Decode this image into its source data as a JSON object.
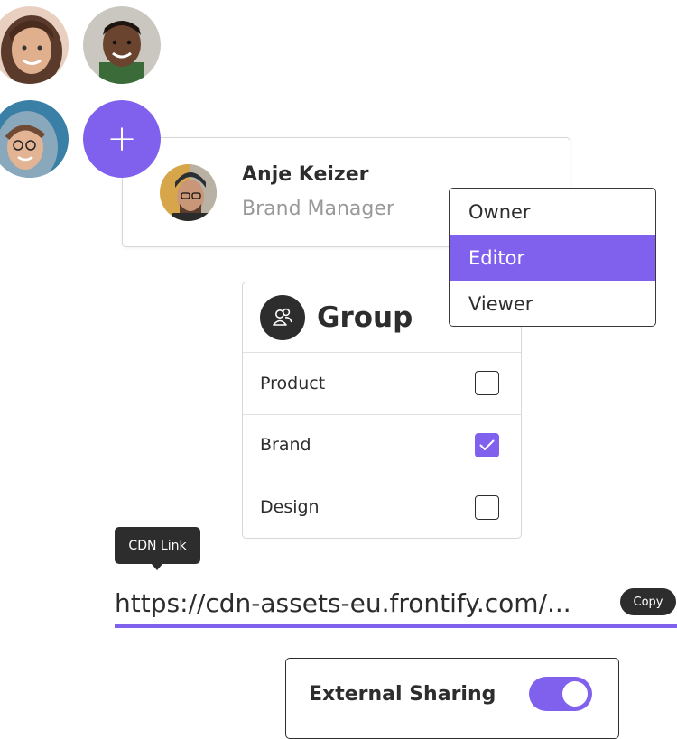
{
  "colors": {
    "accent": "#8061ee",
    "dark": "#2d2d2d"
  },
  "avatars": [
    {
      "name": "avatar-woman-smiling"
    },
    {
      "name": "avatar-man-smiling"
    },
    {
      "name": "avatar-woman-hoodie"
    }
  ],
  "add_button": {
    "label": "+",
    "icon": "plus-icon"
  },
  "user_card": {
    "name": "Anje Keizer",
    "role": "Brand Manager"
  },
  "role_menu": {
    "options": [
      "Owner",
      "Editor",
      "Viewer"
    ],
    "selected": "Editor"
  },
  "group": {
    "title": "Group",
    "icon": "group-icon",
    "items": [
      {
        "label": "Product",
        "checked": false
      },
      {
        "label": "Brand",
        "checked": true
      },
      {
        "label": "Design",
        "checked": false
      }
    ]
  },
  "cdn": {
    "tooltip": "CDN Link",
    "url": "https://cdn-assets-eu.frontify.com/...",
    "copy_label": "Copy"
  },
  "sharing": {
    "label": "External Sharing",
    "enabled": true
  }
}
